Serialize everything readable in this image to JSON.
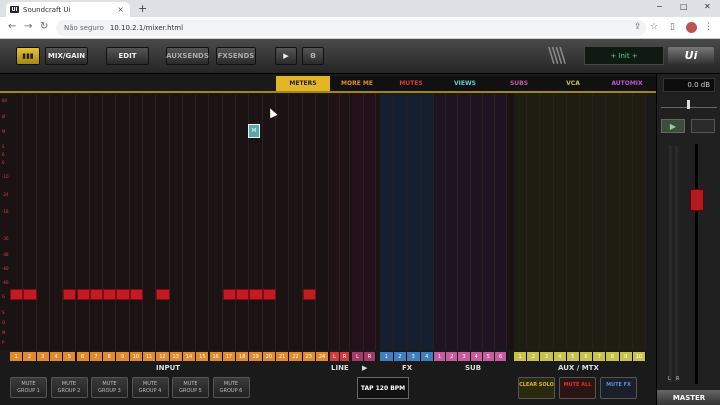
{
  "browser": {
    "tab_title": "Soundcraft Ui",
    "fav": "UI",
    "not_secure": "Não seguro",
    "url": "10.10.2.1/mixer.html",
    "new_tab": "+",
    "minimize": "−",
    "maximize": "□",
    "close": "✕"
  },
  "toolbar": {
    "mixgain": "MIX/GAIN",
    "edit": "EDIT",
    "auxsends": "AUXSENDS",
    "fxsends": "FXSENDS",
    "play": "▶",
    "settings": "⚙",
    "init_display": "+ Init +",
    "logo": "Ui"
  },
  "layer_tabs": [
    "METERS",
    "MORE ME",
    "MUTES",
    "VIEWS",
    "SUBS",
    "VCA",
    "AUTOMIX"
  ],
  "scale_labels": [
    "8X",
    "Ø",
    "M",
    "S",
    "6",
    "0",
    "-10",
    "-24",
    "-18",
    "-36",
    "-48",
    "-60",
    "-66",
    "G",
    "S",
    "O",
    "M",
    "P"
  ],
  "channel_numbers": {
    "input": [
      "1",
      "2",
      "3",
      "4",
      "5",
      "6",
      "7",
      "8",
      "9",
      "10",
      "11",
      "12",
      "13",
      "14",
      "15",
      "16",
      "17",
      "18",
      "19",
      "20",
      "21",
      "22",
      "23",
      "24"
    ],
    "line": [
      "L",
      "R"
    ],
    "play": [
      "L",
      "R"
    ],
    "fx": [
      "1",
      "2",
      "3",
      "4"
    ],
    "sub": [
      "1",
      "2",
      "3",
      "4",
      "5",
      "6"
    ],
    "aux": [
      "1",
      "2",
      "3",
      "4",
      "5",
      "6",
      "7",
      "8",
      "9",
      "10"
    ]
  },
  "group_labels": {
    "input": "INPUT",
    "line": "LINE",
    "fx": "FX",
    "sub": "SUB",
    "aux": "AUX / MTX",
    "play": "▶"
  },
  "mute_groups": [
    "MUTE\nGROUP 1",
    "MUTE\nGROUP 2",
    "MUTE\nGROUP 3",
    "MUTE\nGROUP 4",
    "MUTE\nGROUP 5",
    "MUTE\nGROUP 6"
  ],
  "tap_button": "TAP 120 BPM",
  "right_buttons": {
    "clear_solo": "CLEAR\nSOLO",
    "mute_all": "MUTE\nALL",
    "mute_fx": "MUTE\nFX"
  },
  "master": {
    "db": "0.0 dB",
    "label": "MASTER",
    "l": "L",
    "r": "R"
  },
  "colors": {
    "accent": "#e3b626",
    "input": "#e08a2e",
    "fx": "#3f7fc0",
    "sub": "#c85aa0",
    "aux": "#c9c24a",
    "line": "#d43c3c",
    "mute_red": "#c31a24"
  },
  "solo_active": [
    1,
    2,
    5,
    6,
    7,
    8,
    9,
    10,
    12,
    17,
    18,
    19,
    20,
    23
  ]
}
